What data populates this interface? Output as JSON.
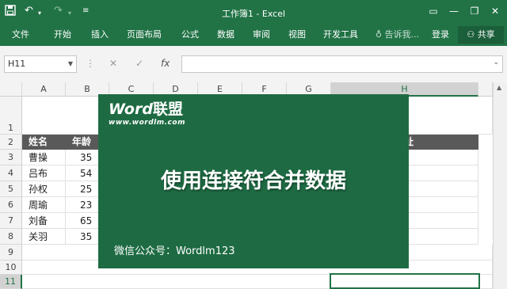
{
  "titlebar": {
    "title": "工作簿1 - Excel",
    "undo": "↶",
    "redo": "↷",
    "customize": "≡",
    "ribbon_display": "▭",
    "minimize": "—",
    "restore": "❐",
    "close": "✕"
  },
  "tabs": [
    "文件",
    "开始",
    "插入",
    "页面布局",
    "公式",
    "数据",
    "审阅",
    "视图",
    "开发工具"
  ],
  "tell_me": "告诉我...",
  "login": "登录",
  "share": "共享",
  "formula_bar": {
    "name_box": "H11",
    "cancel": "✕",
    "enter": "✓",
    "fx": "fx",
    "value": ""
  },
  "columns": [
    "A",
    "B",
    "C",
    "D",
    "E",
    "F",
    "G",
    "H"
  ],
  "rows": [
    "1",
    "2",
    "3",
    "4",
    "5",
    "6",
    "7",
    "8",
    "9",
    "10",
    "11"
  ],
  "table": {
    "headers": [
      "姓名",
      "年龄",
      "址"
    ],
    "data": [
      [
        "曹操",
        "35"
      ],
      [
        "吕布",
        "54"
      ],
      [
        "孙权",
        "25"
      ],
      [
        "周瑜",
        "23"
      ],
      [
        "刘备",
        "65"
      ],
      [
        "关羽",
        "35"
      ]
    ]
  },
  "selected_cell": "H11",
  "overlay": {
    "logo_word": "Word",
    "logo_cn": "联盟",
    "logo_url": "www.wordlm.com",
    "headline": "使用连接符合并数据",
    "wechat": "微信公众号：Wordlm123",
    "background": "#1e6b43"
  },
  "colors": {
    "accent": "#217346",
    "header_fill": "#595959"
  }
}
